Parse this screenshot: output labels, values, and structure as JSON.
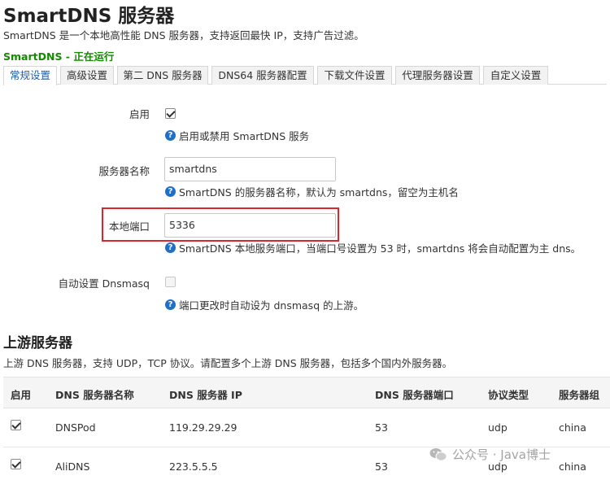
{
  "header": {
    "title": "SmartDNS 服务器",
    "description": "SmartDNS 是一个本地高性能 DNS 服务器，支持返回最快 IP，支持广告过滤。",
    "status": "SmartDNS - 正在运行"
  },
  "tabs": [
    {
      "label": "常规设置",
      "active": true
    },
    {
      "label": "高级设置"
    },
    {
      "label": "第二 DNS 服务器"
    },
    {
      "label": "DNS64 服务器配置"
    },
    {
      "label": "下载文件设置"
    },
    {
      "label": "代理服务器设置"
    },
    {
      "label": "自定义设置"
    }
  ],
  "form": {
    "enable": {
      "label": "启用",
      "checked": true,
      "help": "启用或禁用 SmartDNS 服务"
    },
    "server_name": {
      "label": "服务器名称",
      "value": "smartdns",
      "help": "SmartDNS 的服务器名称，默认为 smartdns，留空为主机名"
    },
    "local_port": {
      "label": "本地端口",
      "value": "5336",
      "help": "SmartDNS 本地服务端口，当端口号设置为 53 时，smartdns 将会自动配置为主 dns。"
    },
    "auto_dnsmasq": {
      "label": "自动设置 Dnsmasq",
      "checked": false,
      "help": "端口更改时自动设为 dnsmasq 的上游。"
    }
  },
  "upstream": {
    "title": "上游服务器",
    "description": "上游 DNS 服务器，支持 UDP，TCP 协议。请配置多个上游 DNS 服务器，包括多个国内外服务器。",
    "columns": [
      "启用",
      "DNS 服务器名称",
      "DNS 服务器 IP",
      "DNS 服务器端口",
      "协议类型",
      "服务器组"
    ],
    "rows": [
      {
        "enabled": true,
        "name": "DNSPod",
        "ip": "119.29.29.29",
        "port": "53",
        "protocol": "udp",
        "group": "china"
      },
      {
        "enabled": true,
        "name": "AliDNS",
        "ip": "223.5.5.5",
        "port": "53",
        "protocol": "udp",
        "group": "china"
      }
    ]
  },
  "watermark": {
    "text": "公众号 · Java博士"
  },
  "help_icon": {
    "glyph": "?"
  },
  "colors": {
    "status": "#138a00",
    "highlight": "#d9262f",
    "active_tab": "#1e5fa8",
    "help_icon": "#1e6fc7"
  }
}
